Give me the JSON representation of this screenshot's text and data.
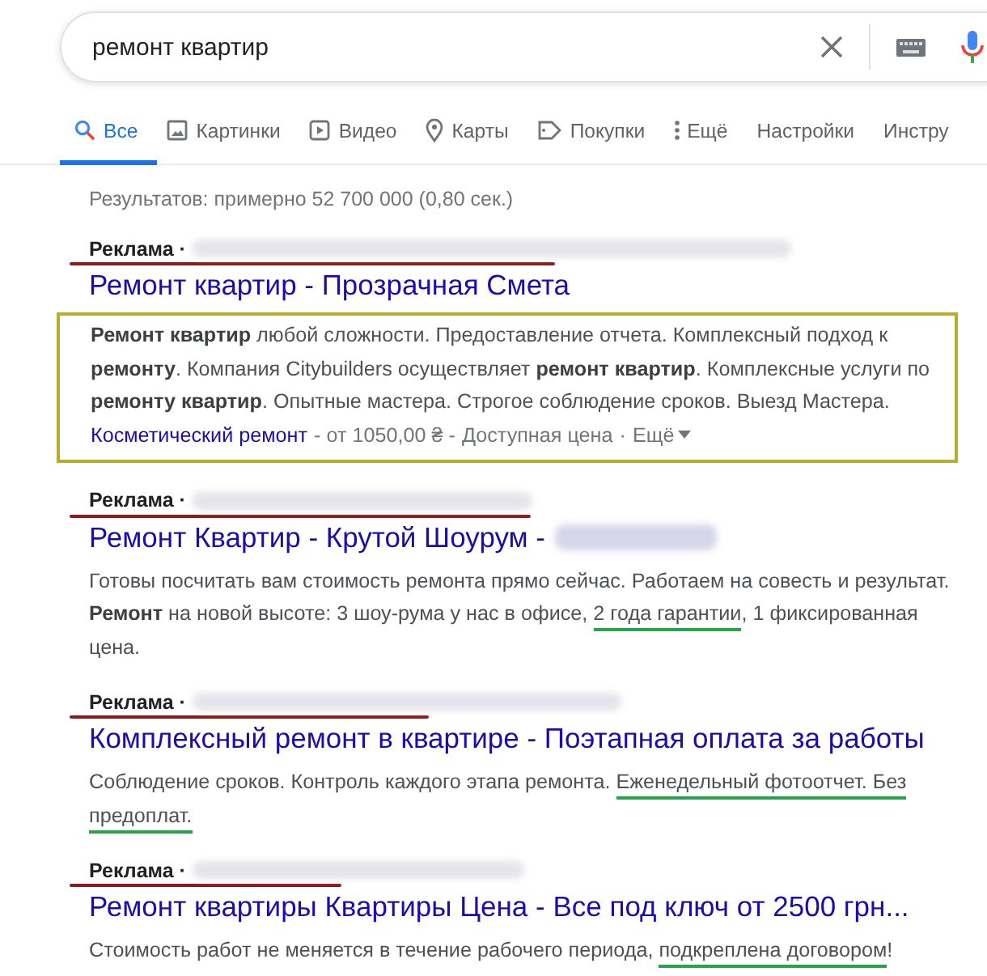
{
  "search": {
    "value": "ремонт квартир"
  },
  "tabs": [
    {
      "label": "Все",
      "selected": true
    },
    {
      "label": "Картинки",
      "selected": false
    },
    {
      "label": "Видео",
      "selected": false
    },
    {
      "label": "Карты",
      "selected": false
    },
    {
      "label": "Покупки",
      "selected": false
    },
    {
      "label": "Ещё",
      "selected": false
    },
    {
      "label": "Настройки",
      "selected": false
    },
    {
      "label": "Инстру",
      "selected": false
    }
  ],
  "result_stats": "Результатов: примерно 52 700 000 (0,80 сек.)",
  "ads": [
    {
      "label": "Реклама ·",
      "title": "Ремонт квартир - Прозрачная Смета",
      "title_blurred_tail": false,
      "framed": true,
      "description": [
        {
          "text": "**Ремонт квартир** любой сложности. Предоставление отчета. Комплексный подход к **ремонту**. Компания Citybuilders осуществляет **ремонт квартир**. Комплексные услуги по **ремонту квартир**. Опытные мастера. Строгое соблюдение сроков. Выезд Мастера.",
          "marked": false
        }
      ],
      "sitelinks": {
        "first": "Косметический ремонт",
        "price": "- от 1050,00 ₴ -",
        "second": "Доступная цена",
        "separator": "·",
        "more": "Ещё"
      }
    },
    {
      "label": "Реклама ·",
      "title": "Ремонт Квартир - Крутой Шоурум -",
      "title_blurred_tail": true,
      "framed": false,
      "description": [
        {
          "text": "Готовы посчитать вам стоимость ремонта прямо сейчас. Работаем на совесть и результат. **Ремонт** на новой высоте: 3 шоу-рума у нас в офисе, ",
          "marked": false
        },
        {
          "text": "2 года гарантии",
          "marked": true
        },
        {
          "text": ", 1 фиксированная цена.",
          "marked": false
        }
      ]
    },
    {
      "label": "Реклама ·",
      "title": "Комплексный ремонт в квартире - Поэтапная оплата за работы",
      "title_blurred_tail": false,
      "framed": false,
      "description": [
        {
          "text": "Соблюдение сроков. Контроль каждого этапа ремонта. ",
          "marked": false
        },
        {
          "text": "Еженедельный фотоотчет. Без ",
          "marked": true
        },
        {
          "text": "предоплат.",
          "marked": true
        }
      ]
    },
    {
      "label": "Реклама ·",
      "title": "Ремонт квартиры Квартиры Цена - Все под ключ от 2500 грн...",
      "title_blurred_tail": false,
      "framed": false,
      "description": [
        {
          "text": "Стоимость работ не меняется в течение рабочего периода, ",
          "marked": false
        },
        {
          "text": "подкреплена договором",
          "marked": true
        },
        {
          "text": "!",
          "marked": false
        }
      ]
    }
  ]
}
